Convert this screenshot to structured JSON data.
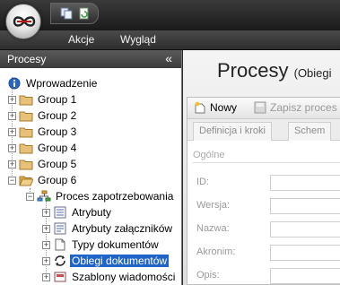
{
  "menu": {
    "items": [
      "Akcje",
      "Wygląd"
    ]
  },
  "left_panel": {
    "title": "Procesy",
    "collapse_glyph": "«",
    "tree": [
      {
        "label": "Wprowadzenie",
        "icon": "info-icon"
      },
      {
        "label": "Group 1",
        "icon": "folder-icon"
      },
      {
        "label": "Group 2",
        "icon": "folder-icon"
      },
      {
        "label": "Group 3",
        "icon": "folder-icon"
      },
      {
        "label": "Group 4",
        "icon": "folder-icon"
      },
      {
        "label": "Group 5",
        "icon": "folder-icon"
      },
      {
        "label": "Group 6",
        "icon": "folder-icon"
      },
      {
        "label": "Proces zapotrzebowania",
        "icon": "process-icon"
      },
      {
        "label": "Atrybuty",
        "icon": "attributes-icon"
      },
      {
        "label": "Atrybuty załączników",
        "icon": "attachment-attributes-icon"
      },
      {
        "label": "Typy dokumentów",
        "icon": "document-types-icon"
      },
      {
        "label": "Obiegi dokumentów",
        "icon": "workflow-icon",
        "selected": true
      },
      {
        "label": "Szablony wiadomości",
        "icon": "message-templates-icon"
      }
    ]
  },
  "main": {
    "title": "Procesy",
    "subtitle": "(Obiegi",
    "toolbar": {
      "new_label": "Nowy",
      "save_label": "Zapisz proces"
    },
    "tabs": [
      "Definicja i kroki",
      "Schem"
    ],
    "section_title": "Ogólne",
    "fields": [
      "ID:",
      "Wersja:",
      "Nazwa:",
      "Akronim:",
      "Opis:"
    ]
  },
  "colors": {
    "selection": "#1f64c6",
    "chrome_dark": "#2e2e2e"
  }
}
